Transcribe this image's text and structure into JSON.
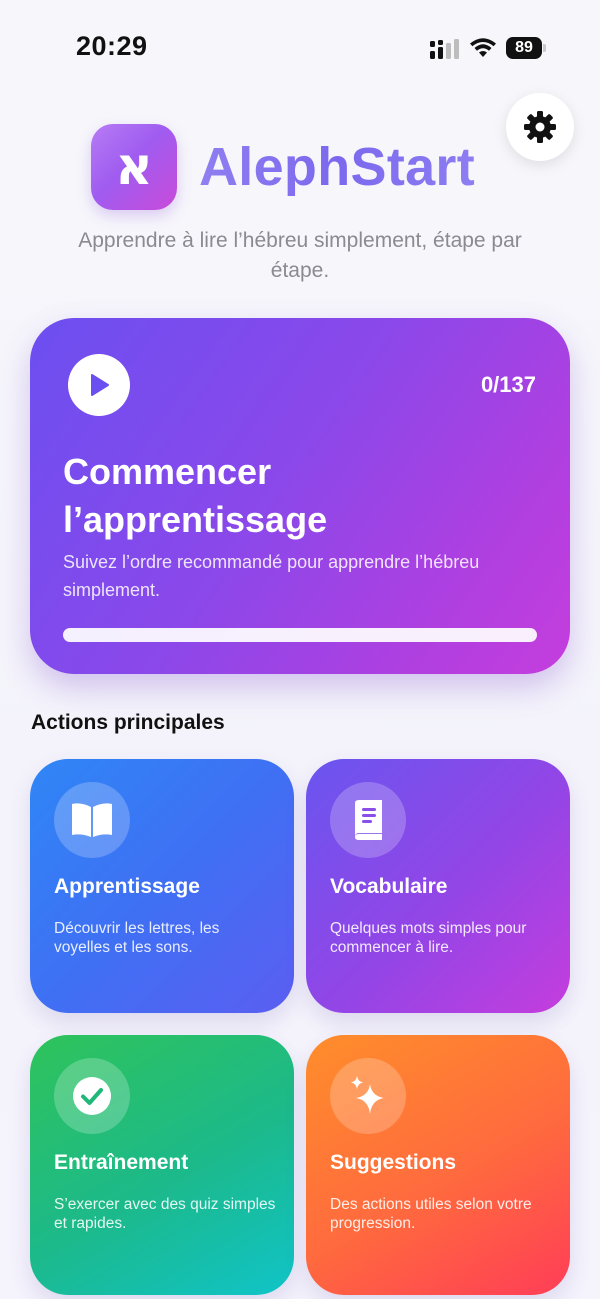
{
  "status_bar": {
    "time": "20:29",
    "battery": "89",
    "signal_icon": "cellular-signal-icon",
    "wifi_icon": "wifi-icon"
  },
  "header": {
    "app_name": "AlephStart",
    "logo_glyph": "א",
    "tagline": "Apprendre à lire l’hébreu simplement, étape par étape.",
    "settings_icon": "gear-icon"
  },
  "hero": {
    "progress": "0/137",
    "progress_fraction": 0,
    "title": "Commencer l’apprentissage",
    "subtitle": "Suivez l’ordre recommandé pour apprendre l’hébreu simplement.",
    "icon": "play-icon",
    "gradient": [
      "#6c4ff0",
      "#c53ddd"
    ]
  },
  "main_actions": {
    "section_title": "Actions principales",
    "cards": [
      {
        "title": "Apprentissage",
        "description": "Découvrir les lettres, les voyelles et les sons.",
        "icon": "open-book-icon",
        "color": "#3f70f4"
      },
      {
        "title": "Vocabulaire",
        "description": "Quelques mots simples pour commencer à lire.",
        "icon": "book-icon",
        "color": "#9445e6"
      },
      {
        "title": "Entraînement",
        "description": "S’exercer avec des quiz simples et rapides.",
        "icon": "checkmark-circle-icon",
        "color": "#1cb98b"
      },
      {
        "title": "Suggestions",
        "description": "Des actions utiles selon votre progression.",
        "icon": "sparkles-icon",
        "color": "#ff6a3e"
      }
    ]
  }
}
